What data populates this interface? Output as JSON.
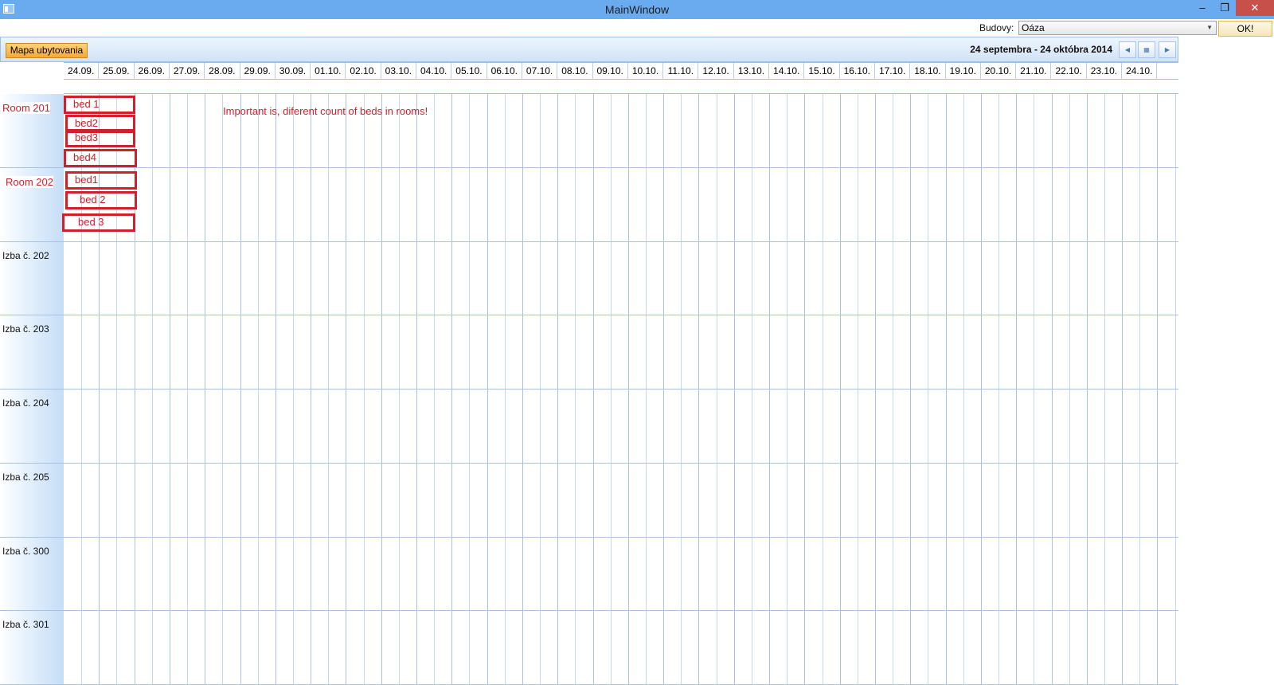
{
  "window": {
    "title": "MainWindow",
    "minimize": "–",
    "restore": "❐",
    "close": "✕"
  },
  "toolbar": {
    "building_label": "Budovy:",
    "building_value": "Oáza",
    "ok_label": "OK!"
  },
  "scheduler": {
    "map_button": "Mapa ubytovania",
    "date_range": "24 septembra - 24 októbra 2014",
    "days": [
      "24.09.",
      "25.09.",
      "26.09.",
      "27.09.",
      "28.09.",
      "29.09.",
      "30.09.",
      "01.10.",
      "02.10.",
      "03.10.",
      "04.10.",
      "05.10.",
      "06.10.",
      "07.10.",
      "08.10.",
      "09.10.",
      "10.10.",
      "11.10.",
      "12.10.",
      "13.10.",
      "14.10.",
      "15.10.",
      "16.10.",
      "17.10.",
      "18.10.",
      "19.10.",
      "20.10.",
      "21.10.",
      "22.10.",
      "23.10.",
      "24.10."
    ],
    "rooms": [
      "Room 201",
      "Room 202",
      "Izba č. 202",
      "Izba č. 203",
      "Izba č. 204",
      "Izba č. 205",
      "Izba č. 300",
      "Izba č. 301"
    ]
  },
  "annotations": {
    "room201_beds": [
      "bed 1",
      "bed2",
      "bed3",
      "bed4"
    ],
    "room202_beds": [
      "bed1",
      "bed 2",
      "bed 3"
    ],
    "note": "Important is, diferent count of beds in rooms!"
  },
  "colors": {
    "titlebar": "#6aabf0",
    "close_button": "#c7504b",
    "annotation_red": "#d0202b",
    "grid_line": "#c5d8ee"
  }
}
